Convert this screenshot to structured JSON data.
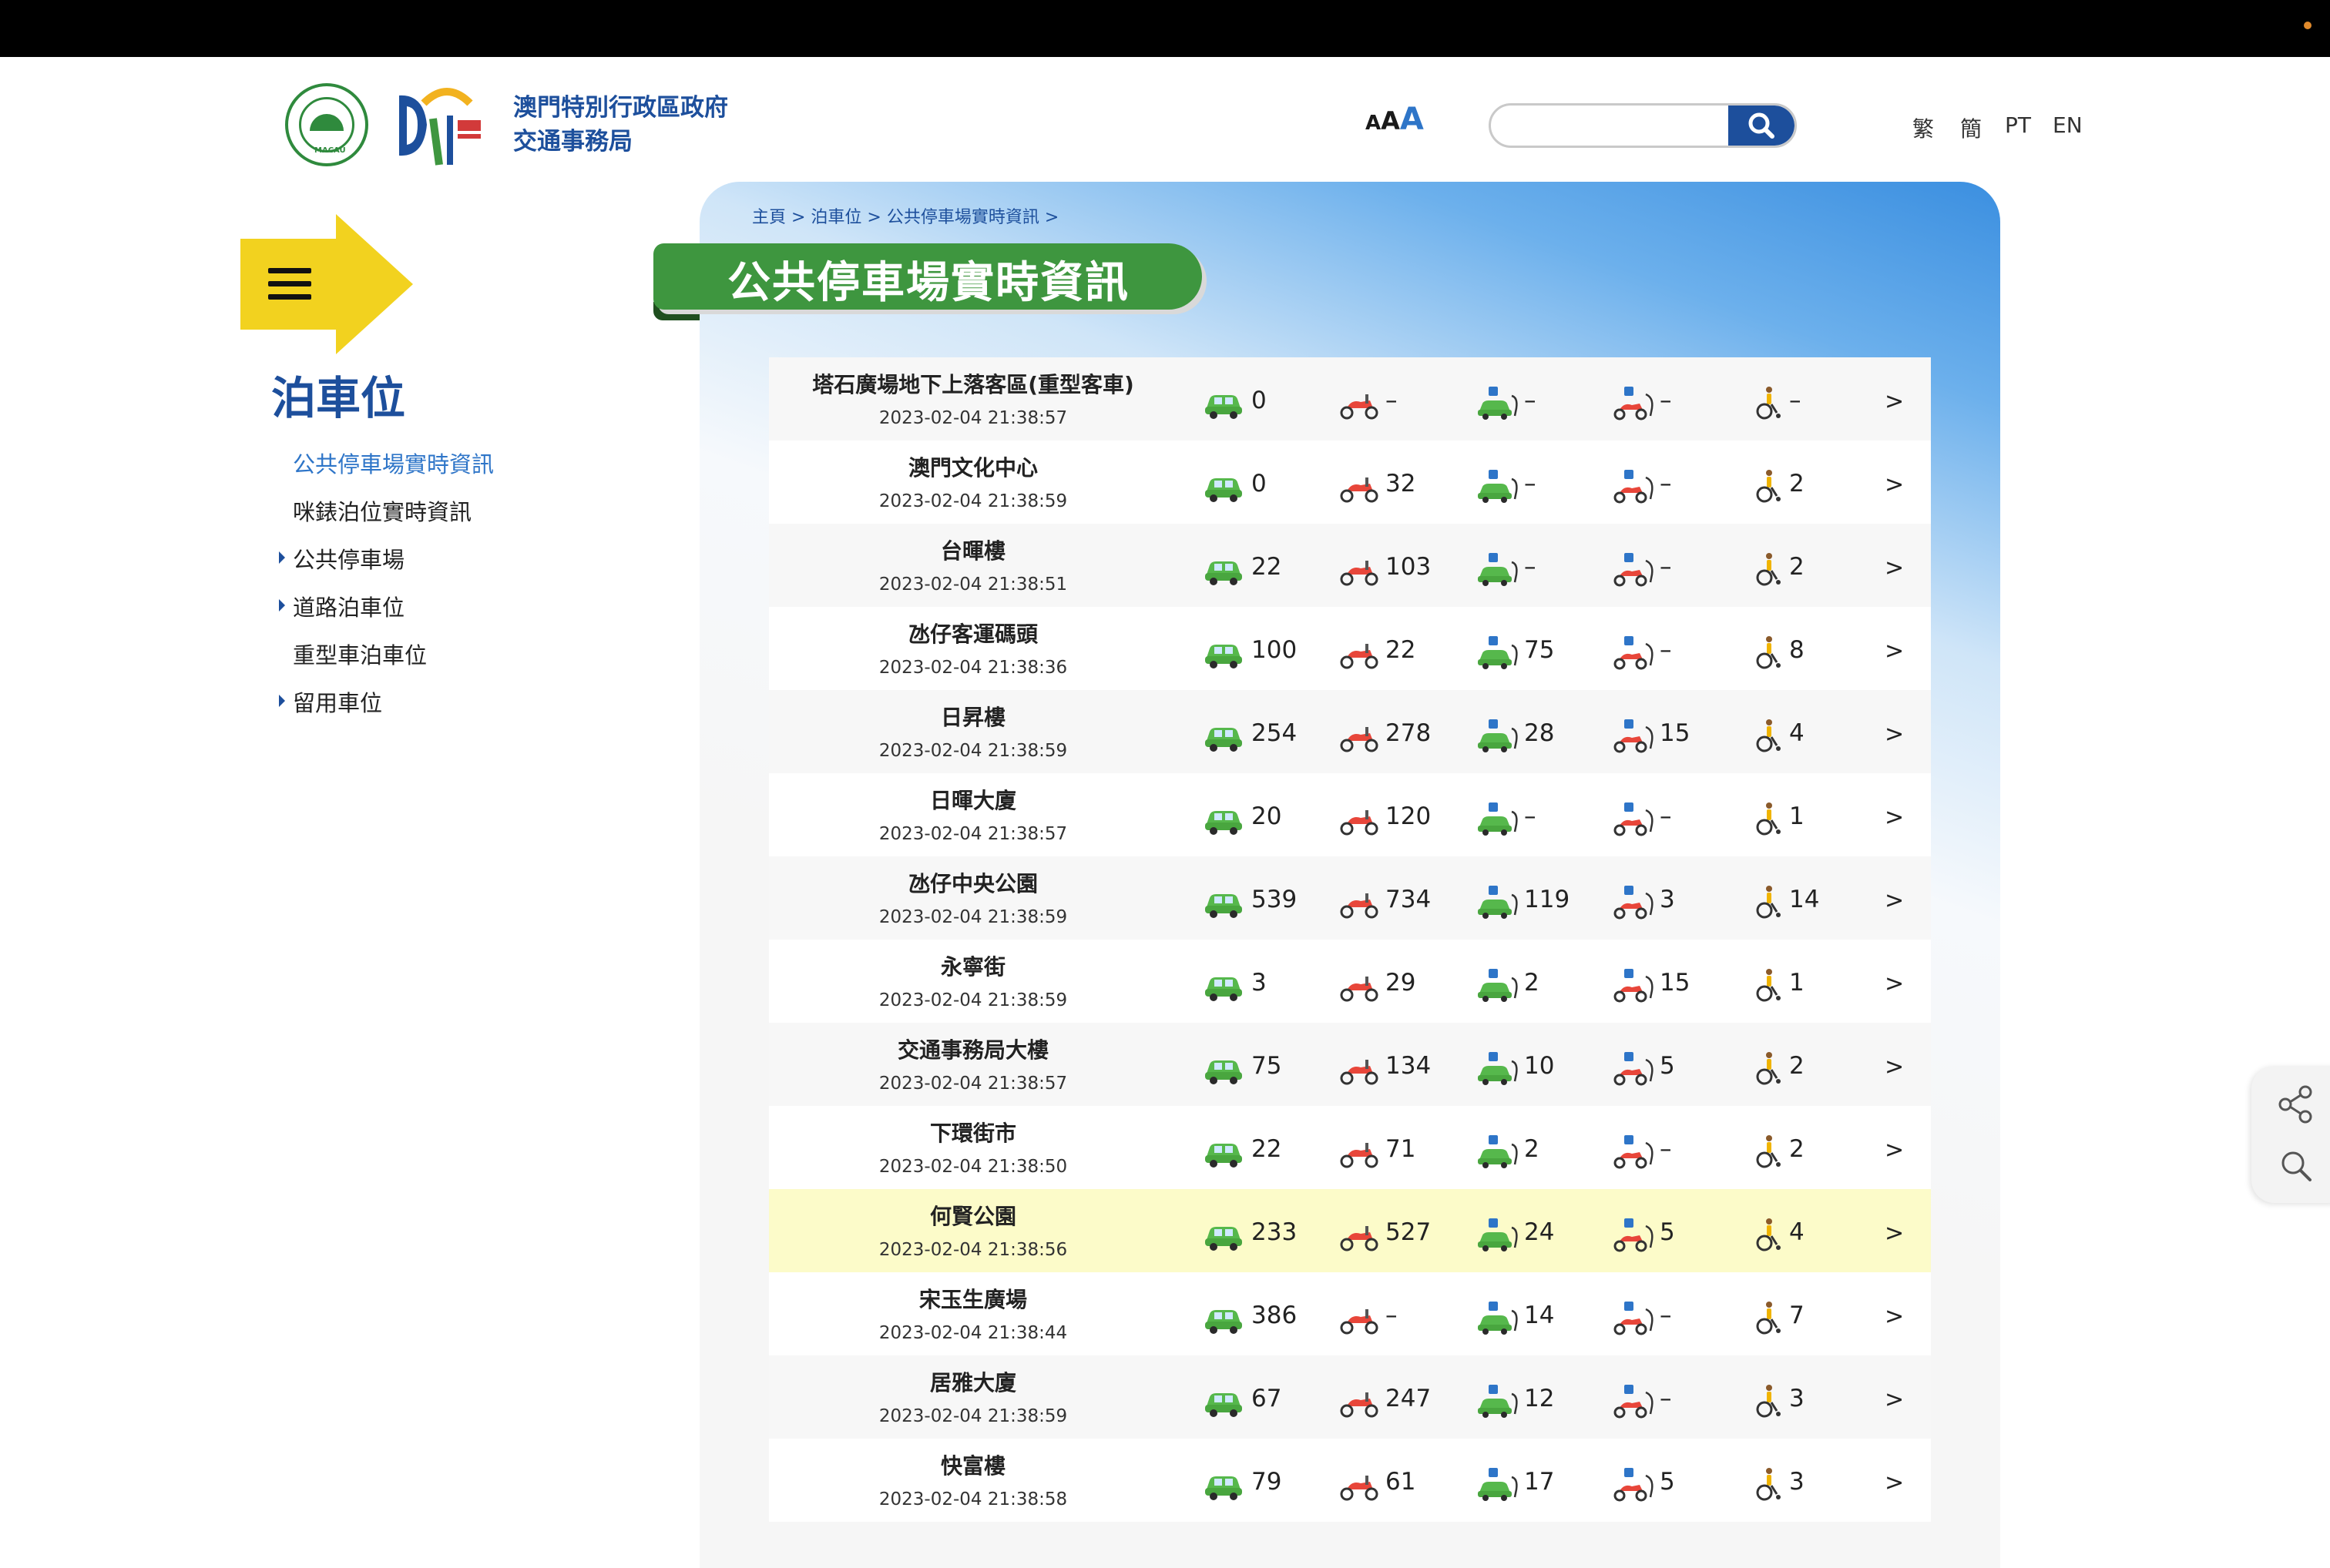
{
  "header": {
    "org_line1": "澳門特別行政區政府",
    "org_line2": "交通事務局",
    "font_size_labels": [
      "A",
      "A",
      "A"
    ],
    "search": {
      "placeholder": "",
      "value": ""
    },
    "languages": [
      "繁",
      "簡",
      "PT",
      "EN"
    ],
    "emblem_text": "MACAU"
  },
  "sidebar": {
    "title": "泊車位",
    "items": [
      {
        "label": "公共停車場實時資訊",
        "active": true,
        "expandable": false
      },
      {
        "label": "咪錶泊位實時資訊",
        "active": false,
        "expandable": false
      },
      {
        "label": "公共停車場",
        "active": false,
        "expandable": true
      },
      {
        "label": "道路泊車位",
        "active": false,
        "expandable": true
      },
      {
        "label": "重型車泊車位",
        "active": false,
        "expandable": false
      },
      {
        "label": "留用車位",
        "active": false,
        "expandable": true
      }
    ]
  },
  "breadcrumb": "主頁 > 泊車位 > 公共停車場實時資訊 >",
  "page_title": "公共停車場實時資訊",
  "icons": [
    "car-icon",
    "motorcycle-icon",
    "ev-car-charging-icon",
    "ev-motorcycle-charging-icon",
    "accessible-icon"
  ],
  "more_label": ">",
  "carparks": [
    {
      "name": "塔石廣場地下上落客區(重型客車)",
      "time": "2023-02-04 21:38:57",
      "car": "0",
      "moto": "–",
      "ev_car": "–",
      "ev_moto": "–",
      "disabled": "–"
    },
    {
      "name": "澳門文化中心",
      "time": "2023-02-04 21:38:59",
      "car": "0",
      "moto": "32",
      "ev_car": "–",
      "ev_moto": "–",
      "disabled": "2"
    },
    {
      "name": "台暉樓",
      "time": "2023-02-04 21:38:51",
      "car": "22",
      "moto": "103",
      "ev_car": "–",
      "ev_moto": "–",
      "disabled": "2"
    },
    {
      "name": "氹仔客運碼頭",
      "time": "2023-02-04 21:38:36",
      "car": "100",
      "moto": "22",
      "ev_car": "75",
      "ev_moto": "–",
      "disabled": "8"
    },
    {
      "name": "日昇樓",
      "time": "2023-02-04 21:38:59",
      "car": "254",
      "moto": "278",
      "ev_car": "28",
      "ev_moto": "15",
      "disabled": "4"
    },
    {
      "name": "日暉大廈",
      "time": "2023-02-04 21:38:57",
      "car": "20",
      "moto": "120",
      "ev_car": "–",
      "ev_moto": "–",
      "disabled": "1"
    },
    {
      "name": "氹仔中央公園",
      "time": "2023-02-04 21:38:59",
      "car": "539",
      "moto": "734",
      "ev_car": "119",
      "ev_moto": "3",
      "disabled": "14"
    },
    {
      "name": "永寧街",
      "time": "2023-02-04 21:38:59",
      "car": "3",
      "moto": "29",
      "ev_car": "2",
      "ev_moto": "15",
      "disabled": "1"
    },
    {
      "name": "交通事務局大樓",
      "time": "2023-02-04 21:38:57",
      "car": "75",
      "moto": "134",
      "ev_car": "10",
      "ev_moto": "5",
      "disabled": "2"
    },
    {
      "name": "下環街市",
      "time": "2023-02-04 21:38:50",
      "car": "22",
      "moto": "71",
      "ev_car": "2",
      "ev_moto": "–",
      "disabled": "2"
    },
    {
      "name": "何賢公園",
      "time": "2023-02-04 21:38:56",
      "car": "233",
      "moto": "527",
      "ev_car": "24",
      "ev_moto": "5",
      "disabled": "4",
      "highlight": true
    },
    {
      "name": "宋玉生廣場",
      "time": "2023-02-04 21:38:44",
      "car": "386",
      "moto": "–",
      "ev_car": "14",
      "ev_moto": "–",
      "disabled": "7"
    },
    {
      "name": "居雅大廈",
      "time": "2023-02-04 21:38:59",
      "car": "67",
      "moto": "247",
      "ev_car": "12",
      "ev_moto": "–",
      "disabled": "3"
    },
    {
      "name": "快富樓",
      "time": "2023-02-04 21:38:58",
      "car": "79",
      "moto": "61",
      "ev_car": "17",
      "ev_moto": "5",
      "disabled": "3"
    }
  ],
  "colors": {
    "brand_blue": "#1d4f9c",
    "link_blue": "#2e75c8",
    "title_green": "#3e963f",
    "menu_yellow": "#f2d21f",
    "highlight_row": "#fcfbc9"
  },
  "float_tools": [
    "share-icon",
    "search-icon"
  ]
}
